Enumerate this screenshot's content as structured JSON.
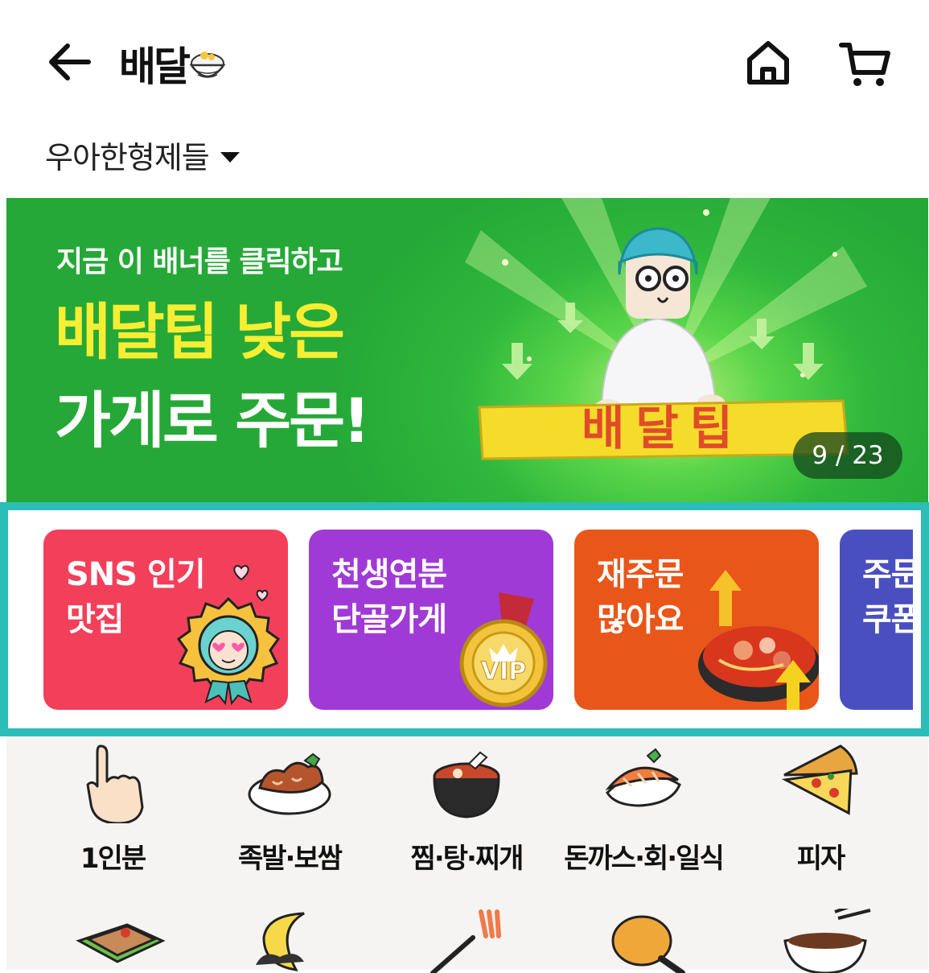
{
  "header": {
    "brand": "배달",
    "back_icon": "arrow-left-icon",
    "home_icon": "home-icon",
    "cart_icon": "cart-icon"
  },
  "location": {
    "label": "우아한형제들"
  },
  "banner": {
    "subtitle": "지금 이 배너를 클릭하고",
    "headline_line1": "배달팁 낮은",
    "headline_line2": "가게로 주문!",
    "sign_text": "배달팁",
    "counter": "9 / 23",
    "colors": {
      "bg": "#2fb83c",
      "accent": "#f7ee33"
    }
  },
  "feature_cards": [
    {
      "title": "SNS 인기\n맛집",
      "color": "#f2405a"
    },
    {
      "title": "천생연분\n단골가게",
      "color": "#a03ad6"
    },
    {
      "title": "재주문\n많아요",
      "color": "#e8561a"
    },
    {
      "title": "주문\n쿠폰",
      "color": "#4a4fc0"
    }
  ],
  "categories": [
    {
      "label": "1인분",
      "icon": "one-person-hand-icon"
    },
    {
      "label": "족발·보쌈",
      "icon": "pork-feet-icon"
    },
    {
      "label": "찜·탕·찌개",
      "icon": "stew-pot-icon"
    },
    {
      "label": "돈까스·회·일식",
      "icon": "sushi-icon"
    },
    {
      "label": "피자",
      "icon": "pizza-icon"
    }
  ],
  "categories_row2_icons": [
    "lunchbox-icon",
    "late-night-moon-icon",
    "noodle-fork-icon",
    "chicken-drumstick-icon",
    "noodle-bowl-icon"
  ],
  "highlight_color": "#2cbdb6"
}
